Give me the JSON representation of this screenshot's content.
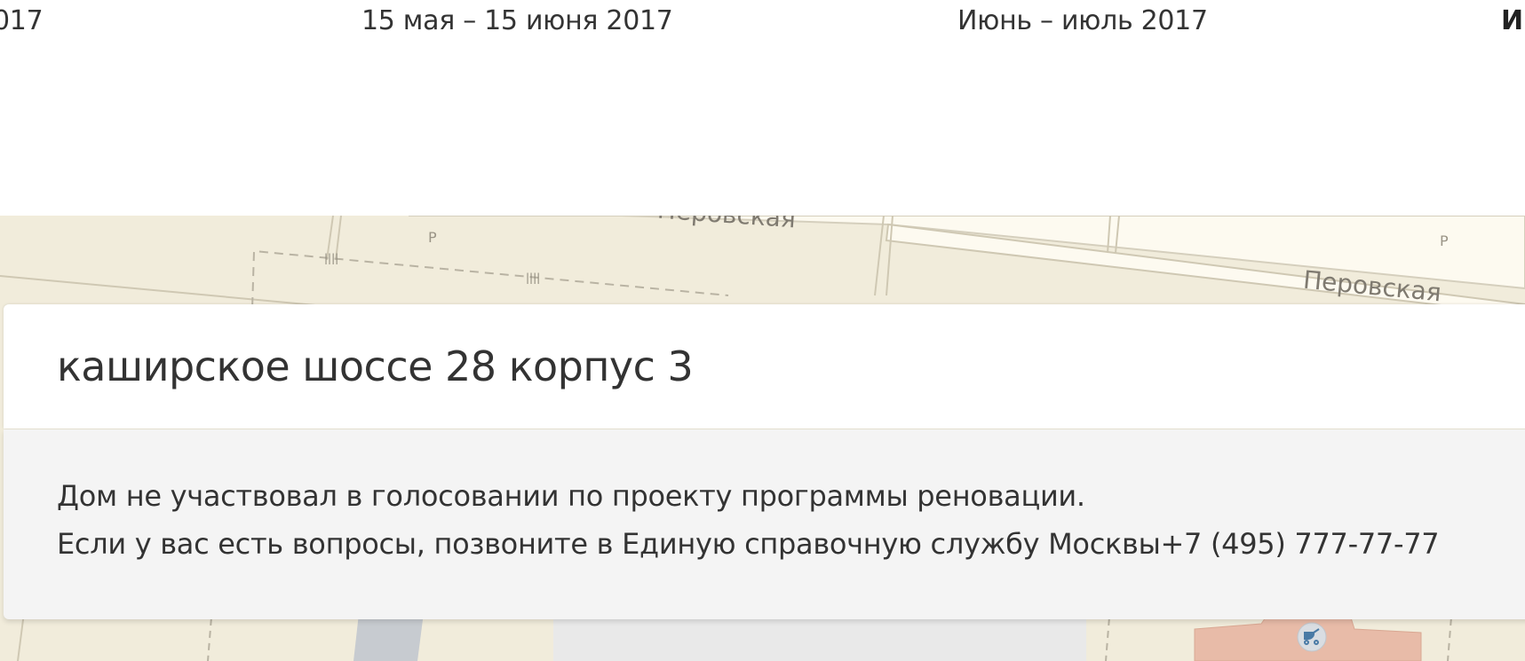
{
  "timeline": {
    "items": [
      {
        "label": "017"
      },
      {
        "label": "15 мая – 15 июня 2017"
      },
      {
        "label": "Июнь – июль 2017"
      },
      {
        "label": "И"
      }
    ]
  },
  "map": {
    "street_labels": [
      "Перовская",
      "Перовская"
    ],
    "parking_labels": [
      "P",
      "P"
    ],
    "icons": [
      "stroller-icon"
    ]
  },
  "search": {
    "value": "каширское шоссе 28 корпус 3",
    "placeholder": ""
  },
  "result": {
    "line1": "Дом не участвовал в голосовании по проекту программы реновации.",
    "line2": "Если у вас есть вопросы, позвоните в Единую справочную службу Москвы+7 (495) 777-77-77"
  },
  "colors": {
    "map_background": "#f1ecdb",
    "road": "#fdfaf0",
    "panel_background": "#f4f4f4",
    "text": "#333333"
  }
}
